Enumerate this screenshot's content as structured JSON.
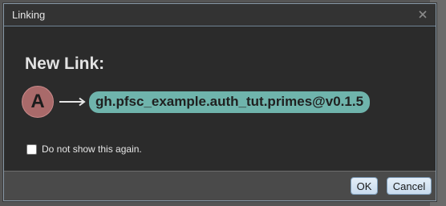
{
  "dialog": {
    "title": "Linking",
    "heading": "New Link:",
    "source_avatar_letter": "A",
    "link_target": "gh.pfsc_example.auth_tut.primes@v0.1.5",
    "checkbox_label": "Do not show this again.",
    "checkbox_checked": false
  },
  "buttons": {
    "ok_label": "OK",
    "cancel_label": "Cancel"
  },
  "icons": {
    "close": "close-icon",
    "arrow": "long-right-arrow-icon"
  },
  "colors": {
    "avatar_bg": "#a96a6a",
    "link_pill_bg": "#6fb4ac",
    "dialog_bg": "#2b2b2b",
    "button_bg": "#d5e4f3"
  }
}
